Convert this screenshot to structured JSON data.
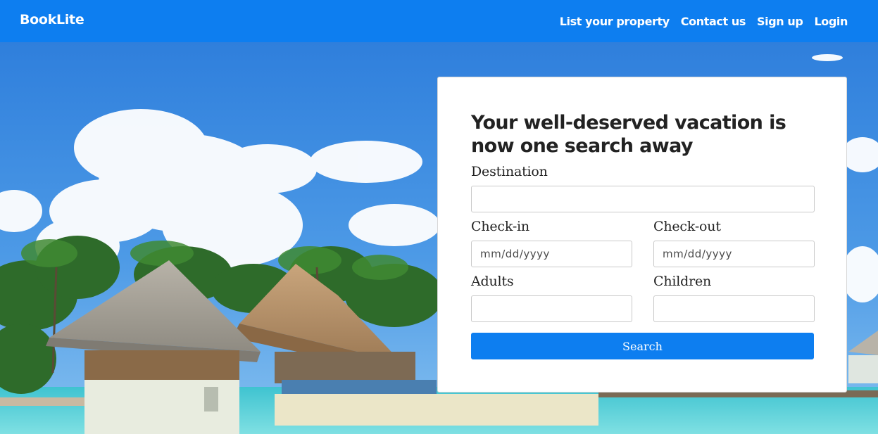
{
  "brand": {
    "name": "BookLite",
    "color": "#0d7ef0"
  },
  "nav": {
    "items": [
      {
        "label": "List your property"
      },
      {
        "label": "Contact us"
      },
      {
        "label": "Sign up"
      },
      {
        "label": "Login"
      }
    ]
  },
  "search": {
    "title": "Your well-deserved vacation is now one search away",
    "destination": {
      "label": "Destination",
      "value": "",
      "placeholder": ""
    },
    "checkin": {
      "label": "Check-in",
      "value": "",
      "placeholder": "mm/dd/yyyy"
    },
    "checkout": {
      "label": "Check-out",
      "value": "",
      "placeholder": "mm/dd/yyyy"
    },
    "adults": {
      "label": "Adults",
      "value": "",
      "placeholder": ""
    },
    "children": {
      "label": "Children",
      "value": "",
      "placeholder": ""
    },
    "button_label": "Search"
  },
  "hero": {
    "image": "tropical-resort-photo"
  }
}
